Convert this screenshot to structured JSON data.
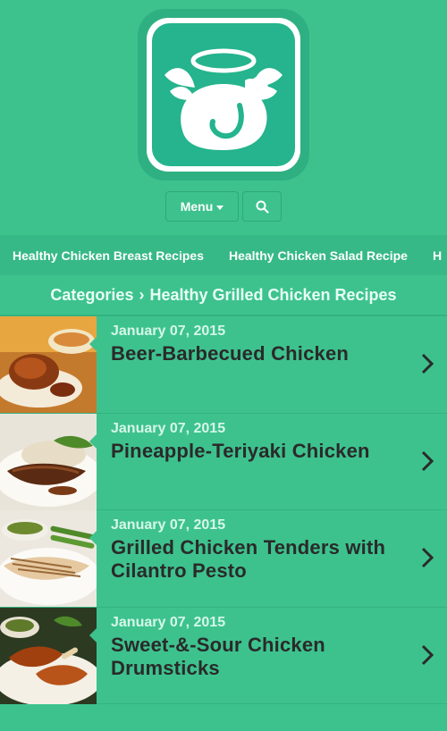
{
  "logo": {
    "icon": "angel-chicken-icon"
  },
  "toolbar": {
    "menu_label": "Menu",
    "search_icon": "search-icon"
  },
  "tags": [
    "Healthy Chicken Breast Recipes",
    "Healthy Chicken Salad Recipe",
    "H"
  ],
  "breadcrumb": {
    "parent": "Categories",
    "separator": "›",
    "current": "Healthy Grilled Chicken Recipes"
  },
  "recipes": [
    {
      "date": "January 07, 2015",
      "title": "Beer-Barbecued Chicken"
    },
    {
      "date": "January 07, 2015",
      "title": "Pineapple-Teriyaki Chicken"
    },
    {
      "date": "January 07, 2015",
      "title": "Grilled Chicken Tenders with Cilantro Pesto"
    },
    {
      "date": "January 07, 2015",
      "title": "Sweet-&-Sour Chicken Drumsticks"
    }
  ],
  "colors": {
    "background": "#3dc28e",
    "tagbar": "#36b986",
    "title_text": "#2a2a2a"
  }
}
